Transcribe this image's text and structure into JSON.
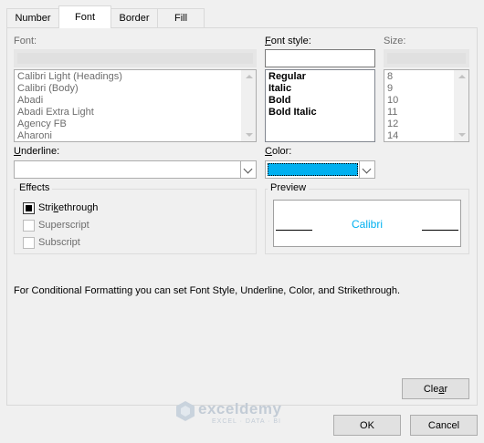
{
  "tabs": [
    {
      "label": "Number"
    },
    {
      "label": "Font"
    },
    {
      "label": "Border"
    },
    {
      "label": "Fill"
    }
  ],
  "font": {
    "label": "Font:",
    "items": [
      "Calibri Light (Headings)",
      "Calibri (Body)",
      "Abadi",
      "Abadi Extra Light",
      "Agency FB",
      "Aharoni"
    ]
  },
  "font_style": {
    "label_pre": "",
    "label_ul": "F",
    "label_post": "ont style:",
    "items": [
      "Regular",
      "Italic",
      "Bold",
      "Bold Italic"
    ]
  },
  "size": {
    "label": "Size:",
    "items": [
      "8",
      "9",
      "10",
      "11",
      "12",
      "14"
    ]
  },
  "underline": {
    "label_ul": "U",
    "label_post": "nderline:"
  },
  "color": {
    "label_ul": "C",
    "label_post": "olor:",
    "swatch": "#00b0f0"
  },
  "effects": {
    "title": "Effects",
    "strikethrough": {
      "pre": "Stri",
      "ul": "k",
      "post": "ethrough",
      "checked": true
    },
    "superscript": {
      "label": "Superscript"
    },
    "subscript": {
      "label": "Subscript"
    }
  },
  "preview": {
    "title": "Preview",
    "sample": "Calibri",
    "sample_color": "#00b0f0"
  },
  "info_text": "For Conditional Formatting you can set Font Style, Underline, Color, and Strikethrough.",
  "buttons": {
    "clear_pre": "Cle",
    "clear_ul": "a",
    "clear_post": "r",
    "ok": "OK",
    "cancel": "Cancel"
  },
  "watermark": {
    "name": "exceldemy",
    "tagline": "EXCEL · DATA · BI"
  }
}
